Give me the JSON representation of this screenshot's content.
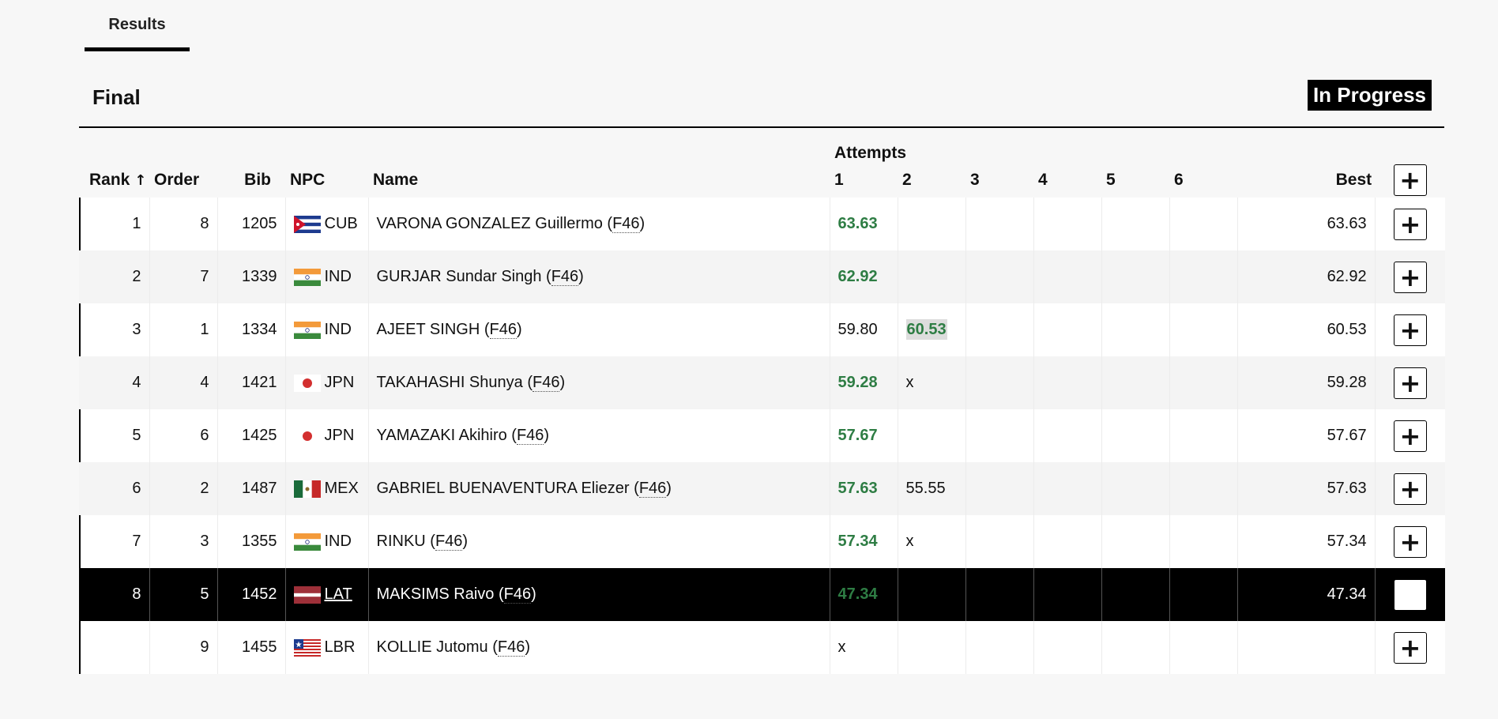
{
  "tabs": [
    {
      "label": "Results"
    }
  ],
  "section": {
    "title": "Final",
    "status": "In Progress"
  },
  "table": {
    "attempts_caption": "Attempts",
    "headers": {
      "rank": "Rank",
      "order": "Order",
      "bib": "Bib",
      "npc": "NPC",
      "name": "Name",
      "a1": "1",
      "a2": "2",
      "a3": "3",
      "a4": "4",
      "a5": "5",
      "a6": "6",
      "best": "Best"
    },
    "sort_icon": "↑",
    "plus_label": "+",
    "rows": [
      {
        "rank": "1",
        "order": "8",
        "bib": "1205",
        "flag": "cuba-flag",
        "npc": "CUB",
        "name": "VARONA GONZALEZ Guillermo",
        "cls": "F46",
        "a1": "63.63",
        "a2": "",
        "a3": "",
        "a4": "",
        "a5": "",
        "a6": "",
        "best": "63.63"
      },
      {
        "rank": "2",
        "order": "7",
        "bib": "1339",
        "flag": "india-flag",
        "npc": "IND",
        "name": "GURJAR Sundar Singh",
        "cls": "F46",
        "a1": "62.92",
        "a2": "",
        "a3": "",
        "a4": "",
        "a5": "",
        "a6": "",
        "best": "62.92"
      },
      {
        "rank": "3",
        "order": "1",
        "bib": "1334",
        "flag": "india-flag",
        "npc": "IND",
        "name": "AJEET SINGH",
        "cls": "F46",
        "a1": "59.80",
        "a2": "60.53",
        "a3": "",
        "a4": "",
        "a5": "",
        "a6": "",
        "best": "60.53"
      },
      {
        "rank": "4",
        "order": "4",
        "bib": "1421",
        "flag": "japan-flag",
        "npc": "JPN",
        "name": "TAKAHASHI Shunya",
        "cls": "F46",
        "a1": "59.28",
        "a2": "x",
        "a3": "",
        "a4": "",
        "a5": "",
        "a6": "",
        "best": "59.28"
      },
      {
        "rank": "5",
        "order": "6",
        "bib": "1425",
        "flag": "japan-flag",
        "npc": "JPN",
        "name": "YAMAZAKI Akihiro",
        "cls": "F46",
        "a1": "57.67",
        "a2": "",
        "a3": "",
        "a4": "",
        "a5": "",
        "a6": "",
        "best": "57.67"
      },
      {
        "rank": "6",
        "order": "2",
        "bib": "1487",
        "flag": "mexico-flag",
        "npc": "MEX",
        "name": "GABRIEL BUENAVENTURA Eliezer",
        "cls": "F46",
        "a1": "57.63",
        "a2": "55.55",
        "a3": "",
        "a4": "",
        "a5": "",
        "a6": "",
        "best": "57.63"
      },
      {
        "rank": "7",
        "order": "3",
        "bib": "1355",
        "flag": "india-flag",
        "npc": "IND",
        "name": "RINKU",
        "cls": "F46",
        "a1": "57.34",
        "a2": "x",
        "a3": "",
        "a4": "",
        "a5": "",
        "a6": "",
        "best": "57.34"
      },
      {
        "rank": "8",
        "order": "5",
        "bib": "1452",
        "flag": "latvia-flag",
        "npc": "LAT",
        "name": "MAKSIMS Raivo",
        "cls": "F46",
        "a1": "47.34",
        "a2": "",
        "a3": "",
        "a4": "",
        "a5": "",
        "a6": "",
        "best": "47.34"
      },
      {
        "rank": "",
        "order": "9",
        "bib": "1455",
        "flag": "liberia-flag",
        "npc": "LBR",
        "name": "KOLLIE Jutomu",
        "cls": "F46",
        "a1": "x",
        "a2": "",
        "a3": "",
        "a4": "",
        "a5": "",
        "a6": "",
        "best": ""
      }
    ]
  },
  "colors": {
    "green": "#2e7d44",
    "highlight_row": "#000000",
    "attempt_highlight": "#dddddd"
  }
}
